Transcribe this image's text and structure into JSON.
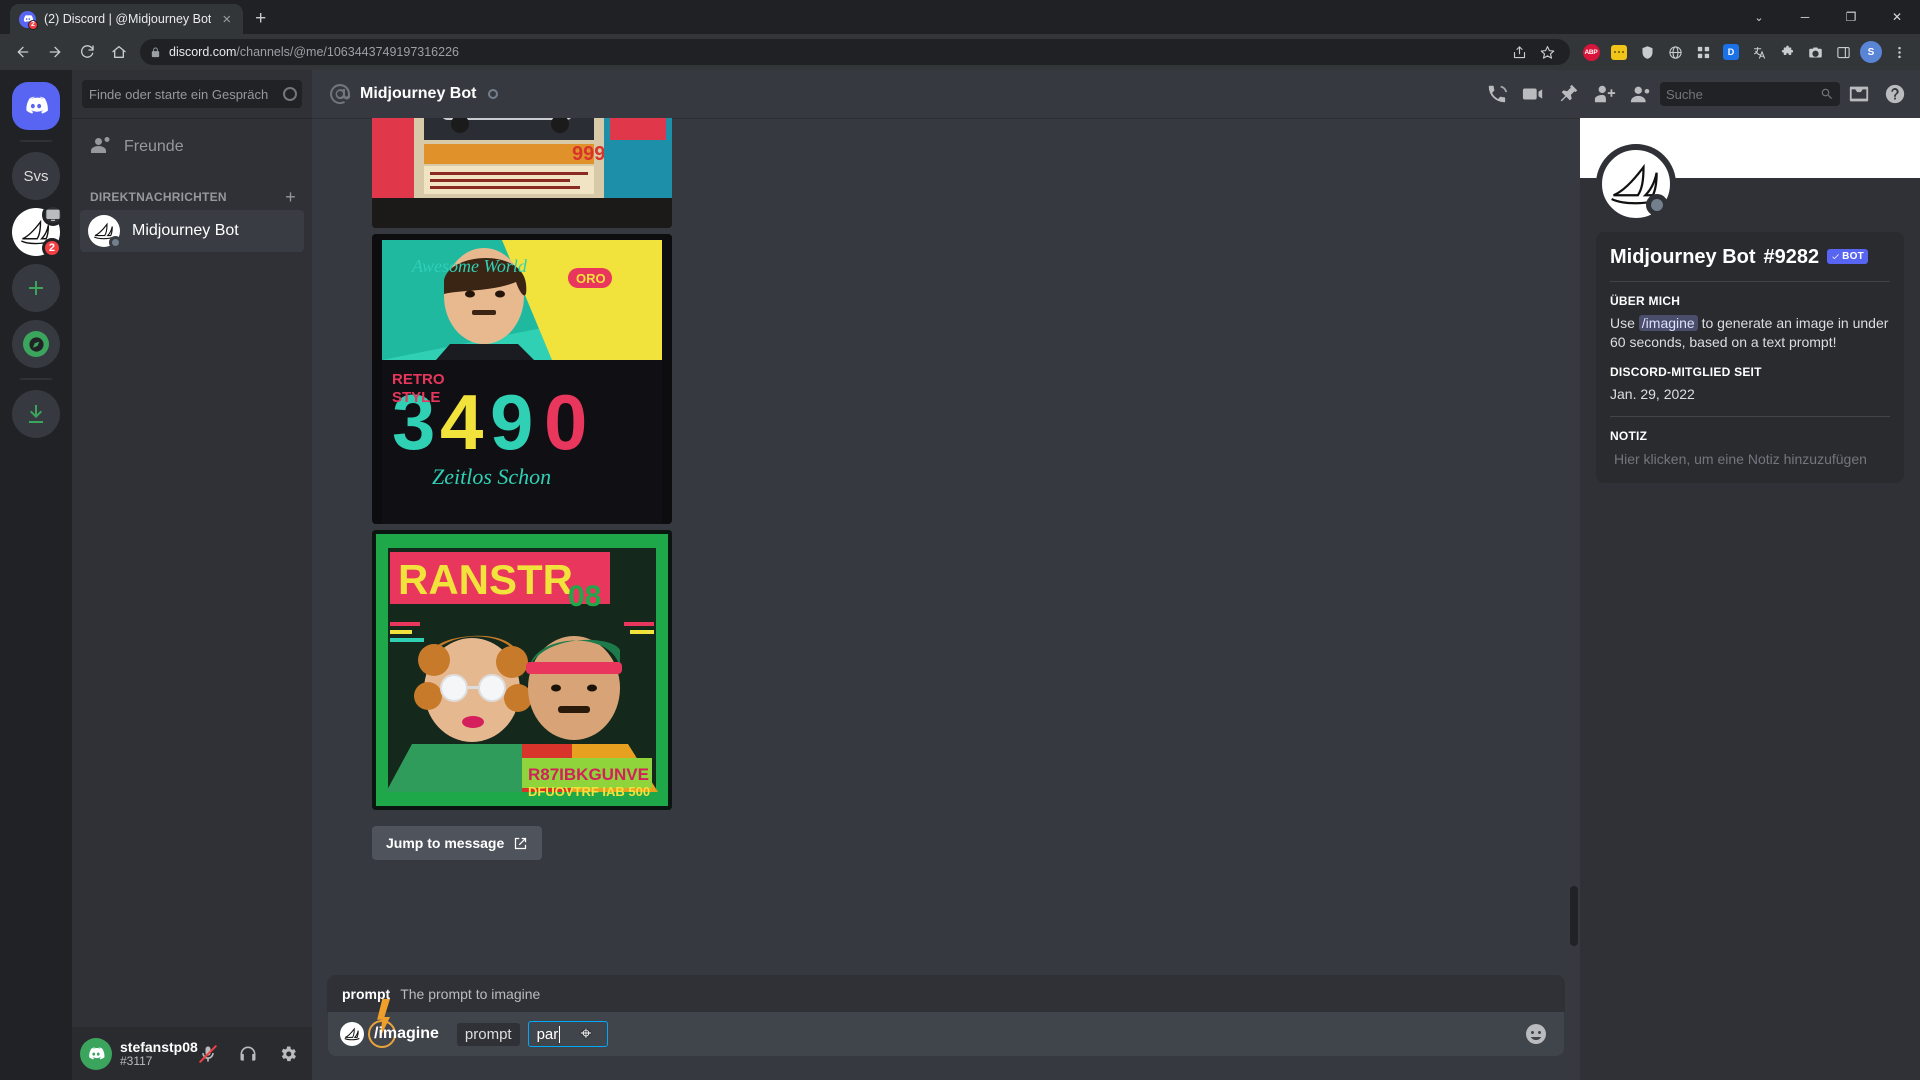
{
  "browser": {
    "tab": {
      "title": "(2) Discord | @Midjourney Bot",
      "favicon_badge": "2",
      "close": "×"
    },
    "new_tab": "+",
    "window_controls": {
      "chevron": "⌄",
      "minimize": "─",
      "maximize": "❐",
      "close": "✕"
    },
    "url": {
      "host": "discord.com",
      "path": "/channels/@me/1063443749197316226"
    },
    "extensions": {
      "abp": "ABP",
      "blue": "D"
    },
    "profile_initial": "S"
  },
  "discord": {
    "guild_rail": {
      "home_label": "Home",
      "servers": [
        {
          "name": "Svs",
          "initials": "Svs"
        },
        {
          "name": "Midjourney",
          "badge": "2"
        }
      ],
      "add_server": "+",
      "explore": "Explore Public Servers",
      "download": "Download Apps"
    },
    "sidebar": {
      "search_placeholder": "Finde oder starte ein Gespräch",
      "friends_label": "Freunde",
      "dm_header": "DIREKTNACHRICHTEN",
      "dm_add": "+",
      "dms": [
        {
          "name": "Midjourney Bot",
          "active": true
        }
      ]
    },
    "user_panel": {
      "username": "stefanstp08",
      "discriminator": "#3117"
    },
    "chat_header": {
      "title": "Midjourney Bot",
      "search_placeholder": "Suche"
    },
    "messages": {
      "jump_to_message": "Jump to message"
    },
    "composer": {
      "arg_name": "prompt",
      "arg_description": "The prompt to imagine",
      "command": "/imagine",
      "arg_chip": "prompt",
      "typed_value": "par"
    },
    "profile": {
      "name": "Midjourney Bot",
      "discriminator": "#9282",
      "bot_badge": "BOT",
      "about_label": "ÜBER MICH",
      "about_prefix": "Use ",
      "about_code": "/imagine",
      "about_suffix": " to generate an image in under 60 seconds, based on a text prompt!",
      "member_since_label": "DISCORD-MITGLIED SEIT",
      "member_since_value": "Jan. 29, 2022",
      "note_label": "NOTIZ",
      "note_placeholder": "Hier klicken, um eine Notiz hinzuzufügen"
    }
  },
  "colors": {
    "blurple": "#5865f2",
    "green": "#3ba55d",
    "red": "#f23f43",
    "input_focus": "#00a8fc",
    "slash_orange": "#f0a02a"
  }
}
